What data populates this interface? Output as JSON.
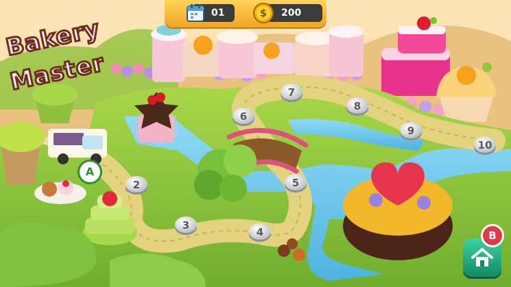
{
  "logo": {
    "line1": "Bakery",
    "line2": "Master"
  },
  "hud": {
    "calendar_value": "01",
    "coin_value": "200",
    "calendar_icon": "calendar-icon",
    "coin_icon": "dollar-coin-icon"
  },
  "levels": [
    "2",
    "3",
    "4",
    "5",
    "6",
    "7",
    "8",
    "9",
    "10"
  ],
  "markers": {
    "a": "A",
    "b": "B"
  },
  "home_button": {
    "icon": "home-icon"
  },
  "colors": {
    "hud_gold": "#f2a421",
    "hud_dark": "#3a3b3b",
    "grass": "#8cc63f",
    "path": "#d4c27a",
    "water": "#6fc8e8",
    "sky": "#f6d99c"
  }
}
